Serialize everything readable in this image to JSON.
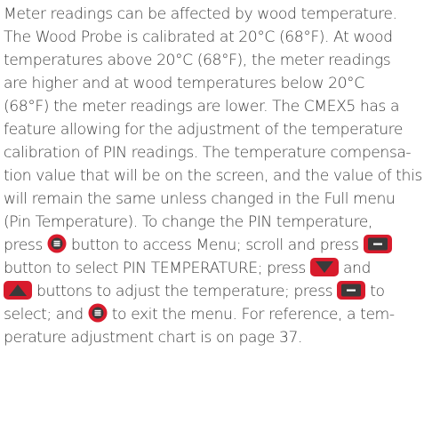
{
  "paragraph": {
    "line1": "Meter readings can be affected by wood temperature.",
    "line2": "The Wood Probe is calibrated at 20°C (68°F). At wood",
    "line3": "temperatures above 20°C (68°F), the meter readings",
    "line4": "are higher and at wood temperatures below 20°C",
    "line5": "(68°F) the meter readings are lower. The CMEX5 has a",
    "line6": "feature allowing for the adjustment of the temperature",
    "line7": "calibration of PIN readings. The temperature compensa-",
    "line8": "tion value that will be on the screen, and the value of this",
    "line9": "will remain the same unless changed in the Full menu",
    "line10": "(Pin Temperature). To change the PIN temperature,",
    "line11a": "press ",
    "line11b": " button to access Menu; scroll and press ",
    "line12a": "button to select PIN TEMPERATURE; press ",
    "line12b": " and",
    "line13a": " buttons to adjust the temperature; press",
    "line13b": " to",
    "line14a": "select; and ",
    "line14b": " to exit the menu. For reference, a tem-",
    "line15": "perature adjustment chart is on page  37."
  },
  "colors": {
    "text": "#3d3d3d",
    "button_red": "#d81b2c",
    "button_dark": "#3a3a3a"
  },
  "icons": {
    "menu_button": "menu-button-icon",
    "select_button": "select-button-icon",
    "down_button": "down-arrow-button-icon",
    "up_button": "up-arrow-button-icon"
  }
}
